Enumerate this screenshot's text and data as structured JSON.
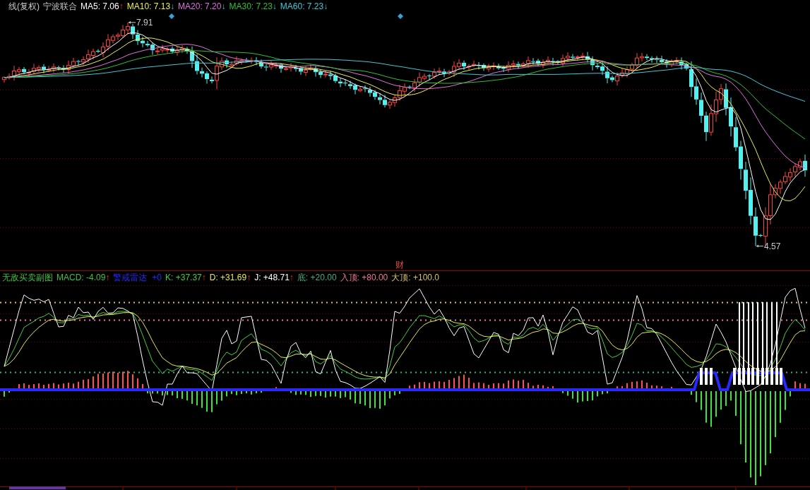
{
  "main_chart": {
    "period": "线(复权)",
    "stock": "宁波联合",
    "ma": [
      {
        "label": "MA5: 7.06",
        "arrow": "↑",
        "rising": true,
        "color": "#ffffff"
      },
      {
        "label": "MA10: 7.13",
        "arrow": "↓",
        "rising": false,
        "color": "#f0f040"
      },
      {
        "label": "MA20: 7.20",
        "arrow": "↓",
        "rising": false,
        "color": "#e070e0"
      },
      {
        "label": "MA30: 7.23",
        "arrow": "↓",
        "rising": false,
        "color": "#30c030"
      },
      {
        "label": "MA60: 7.23",
        "arrow": "↓",
        "rising": false,
        "color": "#40c8d8"
      }
    ],
    "high_label": "7.91",
    "low_label": "4.57",
    "event_mark": "财"
  },
  "sub_chart": {
    "legend": [
      {
        "kind": "title",
        "label": "无敌买卖副图",
        "color": "#40c040"
      },
      {
        "kind": "macd",
        "label": "MACD: -4.09",
        "arrow": "↑",
        "rising": true,
        "color": "#40c040"
      },
      {
        "kind": "radar",
        "label": "警戒雷达",
        "value": "+0",
        "color": "#2828ff"
      },
      {
        "kind": "kdj",
        "label": "K: +37.37",
        "arrow": "↑",
        "rising": true,
        "color": "#40d040"
      },
      {
        "kind": "kdj",
        "label": "D: +31.69",
        "arrow": "↑",
        "rising": true,
        "color": "#e8e850"
      },
      {
        "kind": "kdj",
        "label": "J: +48.71",
        "arrow": "↑",
        "rising": true,
        "color": "#ffffff"
      },
      {
        "kind": "level",
        "label": "底: +20.00",
        "color": "#40b078"
      },
      {
        "kind": "level",
        "label": "入顶: +80.00",
        "color": "#f07890"
      },
      {
        "kind": "level",
        "label": "大顶: +100.0",
        "color": "#d8c068"
      }
    ]
  }
}
